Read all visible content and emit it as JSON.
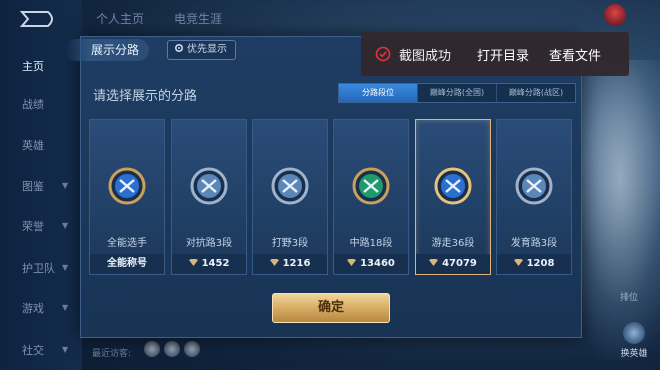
{
  "sidebar": {
    "items": [
      {
        "label": "主页",
        "active": true,
        "caret": false
      },
      {
        "label": "战绩",
        "active": false,
        "caret": false
      },
      {
        "label": "英雄",
        "active": false,
        "caret": false
      },
      {
        "label": "图鉴",
        "active": false,
        "caret": true
      },
      {
        "label": "荣誉",
        "active": false,
        "caret": true
      },
      {
        "label": "护卫队",
        "active": false,
        "caret": true
      },
      {
        "label": "游戏",
        "active": false,
        "caret": true
      },
      {
        "label": "社交",
        "active": false,
        "caret": true
      }
    ]
  },
  "topbar": {
    "tabs": [
      "个人主页",
      "电竞生涯"
    ],
    "settings_label": "设置"
  },
  "modal": {
    "title": "展示分路",
    "priority_button": "优先显示",
    "prompt": "请选择展示的分路",
    "segments": [
      {
        "label": "分路段位",
        "active": true
      },
      {
        "label": "巅峰分路(全国)",
        "active": false
      },
      {
        "label": "巅峰分路(战区)",
        "active": false
      }
    ],
    "cards": [
      {
        "name": "全能选手",
        "footer": "全能称号",
        "gem": false,
        "selected": false,
        "emblem": "all-round-emblem-icon"
      },
      {
        "name": "对抗路3段",
        "footer": "1452",
        "gem": true,
        "selected": false,
        "emblem": "clash-lane-emblem-icon"
      },
      {
        "name": "打野3段",
        "footer": "1216",
        "gem": true,
        "selected": false,
        "emblem": "jungle-emblem-icon"
      },
      {
        "name": "中路18段",
        "footer": "13460",
        "gem": true,
        "selected": false,
        "emblem": "mid-lane-emblem-icon"
      },
      {
        "name": "游走36段",
        "footer": "47079",
        "gem": true,
        "selected": true,
        "emblem": "roam-emblem-icon"
      },
      {
        "name": "发育路3段",
        "footer": "1208",
        "gem": true,
        "selected": false,
        "emblem": "farm-lane-emblem-icon"
      }
    ],
    "confirm_label": "确定"
  },
  "toast": {
    "message": "截图成功",
    "open_folder": "打开目录",
    "view_file": "查看文件"
  },
  "bottom": {
    "recent_label": "最近访客:"
  },
  "right_panel": {
    "leaderboard_label": "排位",
    "change_hero_label": "换英雄"
  },
  "colors": {
    "accent_blue": "#2f7fd8",
    "gold": "#d9b57a",
    "toast_check": "#e0343c"
  }
}
